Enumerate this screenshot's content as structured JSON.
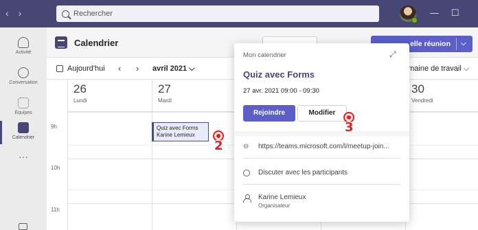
{
  "topbar": {
    "search_placeholder": "Rechercher",
    "back": "‹",
    "forward": "›",
    "minimize": "—",
    "maximize": "☐"
  },
  "rail": {
    "items": [
      {
        "label": "Activité",
        "icon": "bell-icon"
      },
      {
        "label": "Conversation",
        "icon": "chat-icon"
      },
      {
        "label": "Équipes",
        "icon": "teams-icon"
      },
      {
        "label": "Calendrier",
        "icon": "calendar-icon",
        "active": true
      }
    ],
    "more": "···"
  },
  "header": {
    "title": "Calendrier",
    "new_meeting": "elle réunion",
    "new_meeting_chevron": "⌵"
  },
  "toolbar": {
    "today": "Aujourd'hui",
    "prev": "‹",
    "next": "›",
    "month": "avril 2021 ⌵",
    "view": "emaine de travail ⌵"
  },
  "days": [
    {
      "num": "26",
      "name": "Lundi"
    },
    {
      "num": "27",
      "name": "Mardi"
    },
    {
      "num": "",
      "name": ""
    },
    {
      "num": "",
      "name": ""
    },
    {
      "num": "30",
      "name": "Vendredi"
    }
  ],
  "hours": [
    "9h",
    "10h",
    "11h"
  ],
  "event": {
    "title": "Quiz avec Forms",
    "organizer": "Karine Lemieux"
  },
  "popup": {
    "calendar": "Mon calendrier",
    "expand": "⤢",
    "title": "Quiz avec Forms",
    "time": "27 avr. 2021 09:00 - 09:30",
    "join": "Rejoindre",
    "edit": "Modifier",
    "link": "https://teams.microsoft.com/l/meetup-join...",
    "chat": "Discuter avec les participants",
    "organizer_name": "Karine Lemieux",
    "organizer_role": "Organisateur"
  },
  "markers": [
    "2",
    "3"
  ]
}
